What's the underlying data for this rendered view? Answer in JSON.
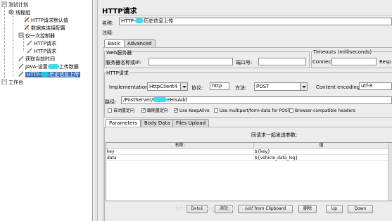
{
  "tree": {
    "root": "测试计划",
    "thread_group": "线程组",
    "n1": "HTTP请求默认值",
    "n2": "数据库连接配置",
    "controller": "仅一次控制器",
    "n3": "HTTP请求",
    "n4": "HTTP请求",
    "n5": "获取当前时间",
    "n6a": "JAVA-设置",
    "n6b": "上传数据",
    "sel_a": "HTTP-",
    "sel_b": "历史信息上传",
    "workbench": "工作台"
  },
  "panel": {
    "title": "HTTP请求",
    "name_label": "名称:",
    "name_a": "HTTP-",
    "name_b": "历史信息上传",
    "comment_label": "注释:"
  },
  "tabs": {
    "basic": "Basic",
    "advanced": "Advanced"
  },
  "web_server": {
    "group": "Web服务器",
    "server_label": "服务器名称或IP:",
    "port_label": "端口号:"
  },
  "timeouts": {
    "group": "Timeouts (milliseconds)",
    "connect_label": "Connect:",
    "response_label": "Resp"
  },
  "http_request": {
    "group": "HTTP请求",
    "impl_label": "Implementation:",
    "impl_value": "HttpClient4",
    "protocol_label": "协议:",
    "protocol_value": "http",
    "method_label": "方法:",
    "method_value": "POST",
    "encoding_label": "Content encoding:",
    "encoding_value": "utf-8",
    "path_label": "路径:",
    "path_a": "/PostServer/",
    "path_b": "eHisAdd"
  },
  "options": {
    "redirect": "自动重定向",
    "follow": "跟随重定向",
    "keepalive": "Use KeepAlive",
    "multipart": "Use multipart/form-data for POST",
    "browser": "Browser-compatible headers"
  },
  "param_tabs": {
    "parameters": "Parameters",
    "body": "Body Data",
    "files": "Files Upload"
  },
  "params": {
    "caption": "同请求一起发送参数:",
    "col_name": "名称:",
    "col_value": "值",
    "rows": [
      {
        "name": "key",
        "value": "${key}"
      },
      {
        "name": "data",
        "value": "${vehicle_data_log}"
      }
    ]
  },
  "buttons": {
    "detail": "Detail",
    "add": "添加",
    "clipboard": "Add from Clipboard",
    "delete": "删除",
    "up": "Up",
    "down": "Down"
  },
  "watermark": "http://blog.csdn.net/...",
  "colors": {
    "selection": "#3b6fb6",
    "redaction": "#22d3ee"
  }
}
